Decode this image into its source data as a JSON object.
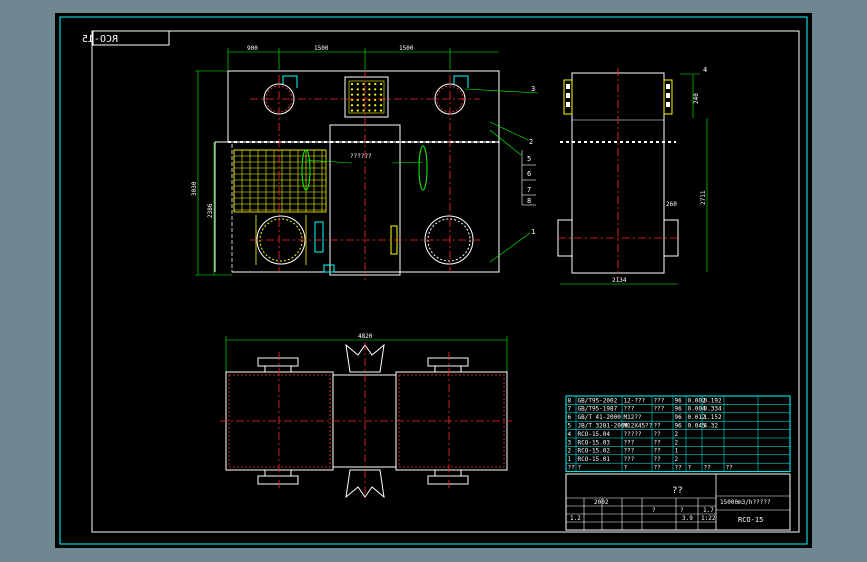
{
  "drawing_code_mirrored": "RCO-15",
  "front_view": {
    "dims_top": [
      "900",
      "1500",
      "1500"
    ],
    "dim_left_outer": "3030",
    "dim_left_inner": "2386",
    "callout_text": "??????"
  },
  "side_view": {
    "dim_top_right": "240",
    "dim_mid_right": "2711",
    "dim_small": "260",
    "dim_bottom": "2134"
  },
  "plan_view": {
    "dim_top": "4820"
  },
  "item_tags": [
    "1",
    "2",
    "3",
    "4",
    "5",
    "6",
    "7",
    "8"
  ],
  "bom": {
    "rows": [
      [
        "8",
        "GB/T95-2002",
        "12-???",
        "???",
        "96",
        "0.002",
        "0.192"
      ],
      [
        "7",
        "GB/T95-1987",
        "???",
        "???",
        "96",
        "0.004",
        "0.334"
      ],
      [
        "6",
        "GB/T 41-2000",
        "M12??",
        "",
        "96",
        "0.012",
        "1.152"
      ],
      [
        "5",
        "JB/T 3281-2000",
        "M12X45??",
        "??",
        "96",
        "0.045",
        "4.32"
      ],
      [
        "4",
        "RCO-15.04",
        "?????",
        "??",
        "2",
        "",
        ""
      ],
      [
        "3",
        "RCO-15.03",
        "???",
        "??",
        "2",
        "",
        ""
      ],
      [
        "2",
        "RCO-15.02",
        "???",
        "??",
        "1",
        "",
        ""
      ],
      [
        "1",
        "RCO-15.01",
        "???",
        "??",
        "2",
        "",
        ""
      ]
    ],
    "header": [
      "??",
      "?",
      "?",
      "??",
      "??",
      "?",
      "??",
      "??"
    ]
  },
  "title_block": {
    "name_cell": "??",
    "title": "15000m3/h?????",
    "drawing_no": "RCO-15",
    "cells": [
      "2002",
      "1.7",
      "?",
      "?",
      "3.9",
      "1:22",
      "1.2"
    ]
  },
  "colors": {
    "frame": "#00ffff",
    "outline": "#ffffff",
    "centerline": "#ff2a2a",
    "hatch": "#ffff00",
    "leader": "#00ff00",
    "access": "#ff00ff"
  }
}
